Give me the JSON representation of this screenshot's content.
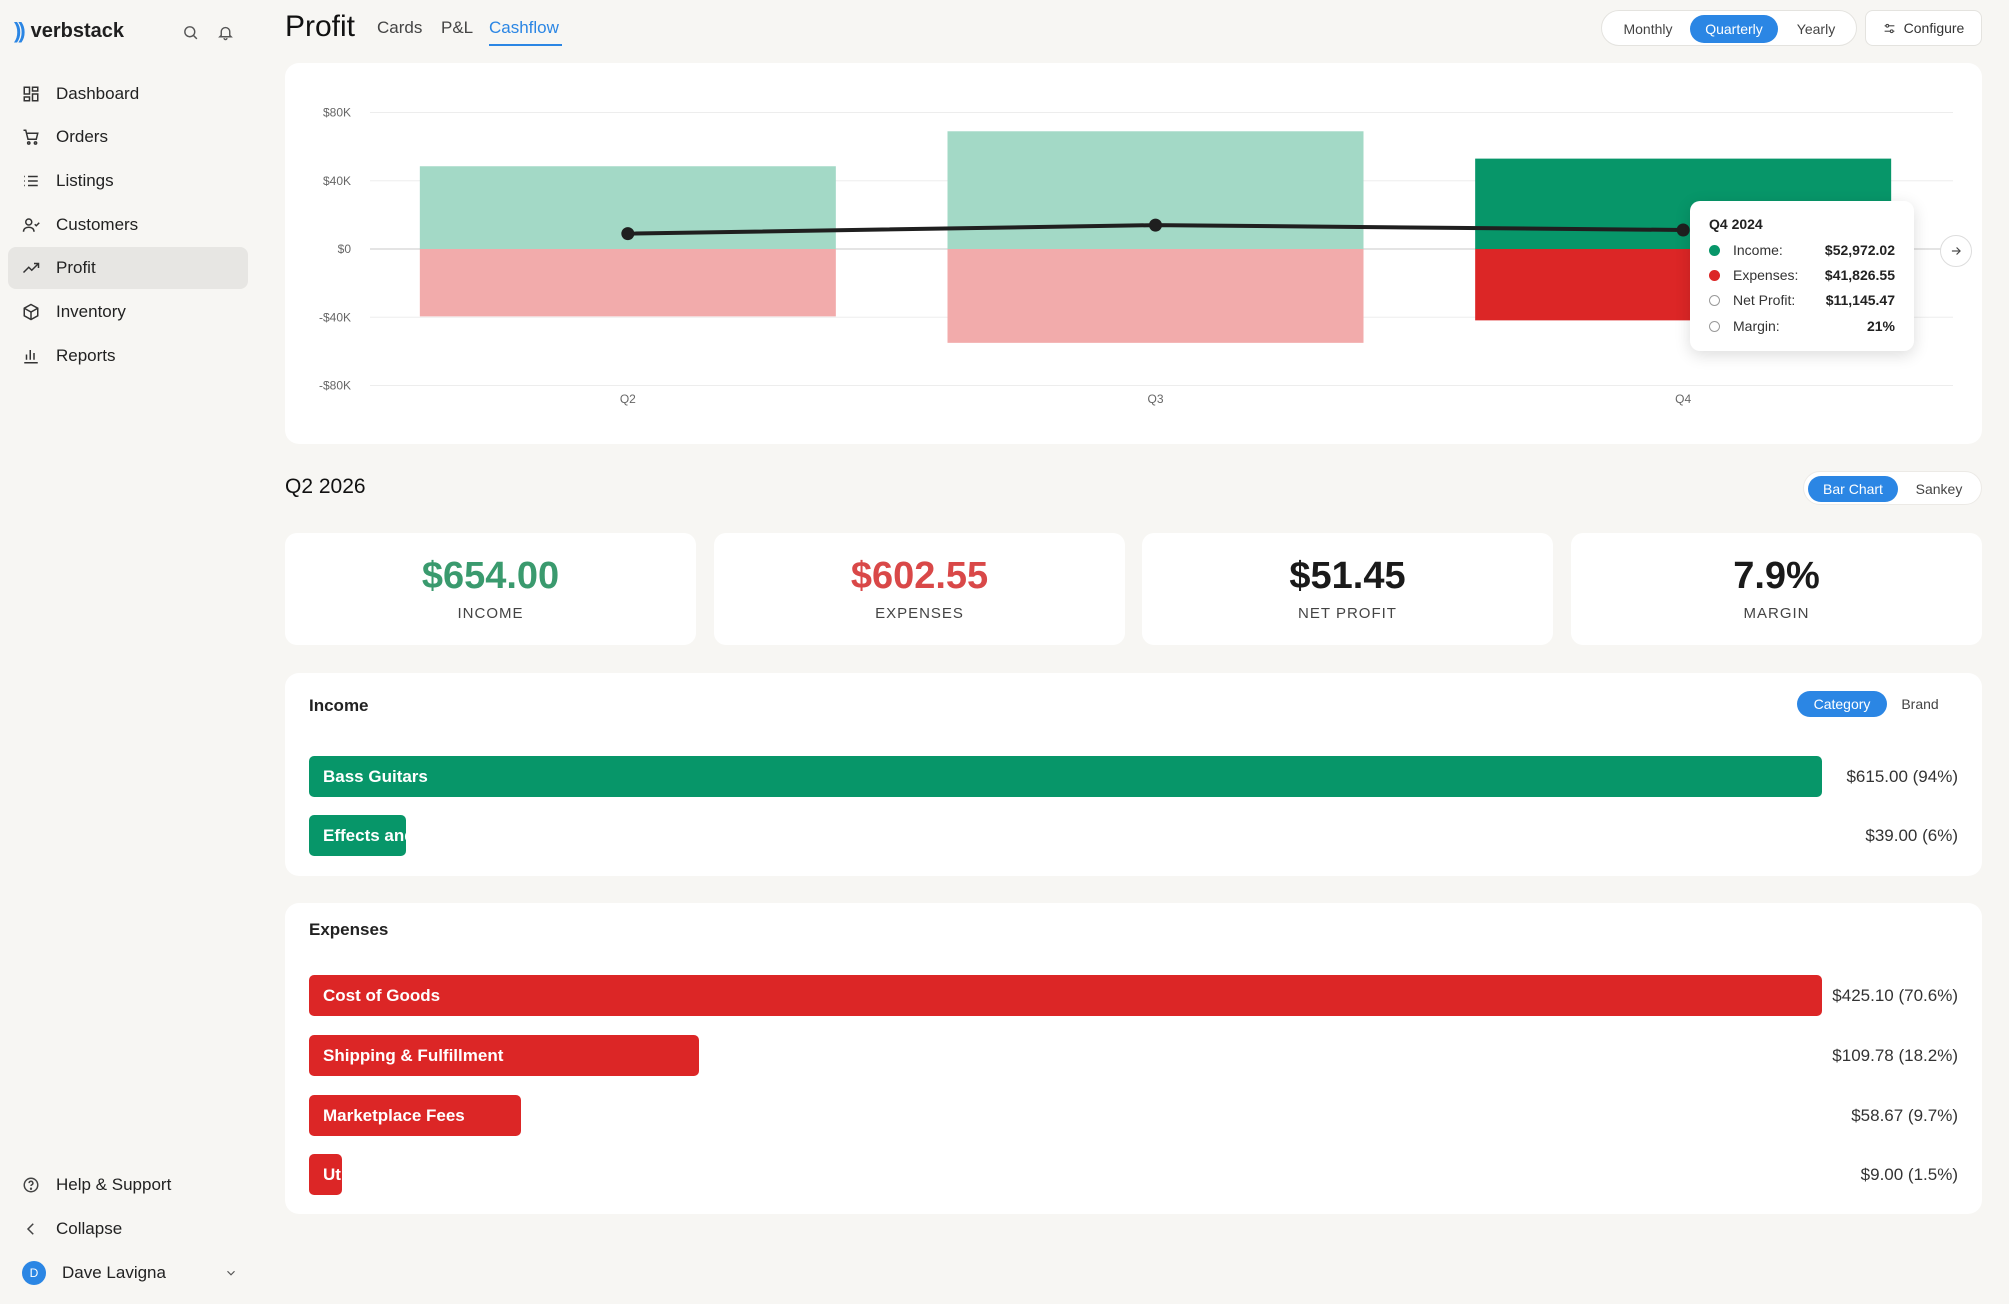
{
  "app": {
    "name": "verbstack"
  },
  "sidebar": {
    "items": [
      {
        "label": "Dashboard",
        "icon": "dashboard-icon"
      },
      {
        "label": "Orders",
        "icon": "cart-icon"
      },
      {
        "label": "Listings",
        "icon": "list-icon"
      },
      {
        "label": "Customers",
        "icon": "user-icon"
      },
      {
        "label": "Profit",
        "icon": "trend-icon",
        "active": true
      },
      {
        "label": "Inventory",
        "icon": "box-icon"
      },
      {
        "label": "Reports",
        "icon": "bar-chart-icon"
      }
    ],
    "help": "Help & Support",
    "collapse": "Collapse",
    "user": {
      "name": "Dave Lavigna",
      "initial": "D"
    }
  },
  "header": {
    "title": "Profit",
    "tabs": [
      {
        "label": "Cards"
      },
      {
        "label": "P&L"
      },
      {
        "label": "Cashflow",
        "active": true
      }
    ],
    "periods": [
      {
        "label": "Monthly"
      },
      {
        "label": "Quarterly",
        "active": true
      },
      {
        "label": "Yearly"
      }
    ],
    "configure": "Configure"
  },
  "chart_data": {
    "type": "bar",
    "categories": [
      "Q2",
      "Q3",
      "Q4"
    ],
    "series": [
      {
        "name": "Income",
        "values": [
          48500,
          69000,
          52972.02
        ]
      },
      {
        "name": "Expenses",
        "values": [
          -39500,
          -55000,
          -41826.55
        ]
      },
      {
        "name": "Net Profit",
        "values": [
          9000,
          14000,
          11145.47
        ]
      }
    ],
    "yticks": [
      "$80K",
      "$40K",
      "$0",
      "-$40K",
      "-$80K"
    ],
    "ylim": [
      -80000,
      80000
    ],
    "grid": true,
    "highlighted": "Q4",
    "colors": {
      "income": "#079669",
      "income_faded": "#a3d9c6",
      "expenses": "#dc2626",
      "expenses_faded": "#f2abab",
      "line": "#1f1f1f"
    },
    "tooltip": {
      "title": "Q4 2024",
      "rows": [
        {
          "label": "Income:",
          "value": "$52,972.02",
          "color": "#079669",
          "filled": true
        },
        {
          "label": "Expenses:",
          "value": "$41,826.55",
          "color": "#dc2626",
          "filled": true
        },
        {
          "label": "Net Profit:",
          "value": "$11,145.47",
          "color": "#9a9a9a",
          "filled": false
        },
        {
          "label": "Margin:",
          "value": "21%",
          "color": "#9a9a9a",
          "filled": false
        }
      ]
    }
  },
  "summary": {
    "period": "Q2 2026",
    "views": [
      {
        "label": "Bar Chart",
        "active": true
      },
      {
        "label": "Sankey"
      }
    ],
    "kpis": [
      {
        "value": "$654.00",
        "label": "INCOME",
        "color": "#3a9a6e"
      },
      {
        "value": "$602.55",
        "label": "EXPENSES",
        "color": "#d94848"
      },
      {
        "value": "$51.45",
        "label": "NET PROFIT",
        "color": "#1a1a1a"
      },
      {
        "value": "7.9%",
        "label": "MARGIN",
        "color": "#1a1a1a"
      }
    ]
  },
  "income": {
    "title": "Income",
    "groupings": [
      {
        "label": "Category",
        "active": true
      },
      {
        "label": "Brand"
      }
    ],
    "color": "#079669",
    "rows": [
      {
        "label": "Bass Guitars",
        "value": "$615.00 (94%)",
        "share": 1.0
      },
      {
        "label": "Effects and Pedals",
        "value": "$39.00 (6%)",
        "share": 0.064
      }
    ]
  },
  "expenses": {
    "title": "Expenses",
    "color": "#dc2626",
    "rows": [
      {
        "label": "Cost of Goods",
        "value": "$425.10 (70.6%)",
        "share": 1.0
      },
      {
        "label": "Shipping & Fulfillment",
        "value": "$109.78 (18.2%)",
        "share": 0.258
      },
      {
        "label": "Marketplace Fees",
        "value": "$58.67 (9.7%)",
        "share": 0.14
      },
      {
        "label": "Utilities",
        "value": "$9.00 (1.5%)",
        "share": 0.022
      }
    ]
  }
}
